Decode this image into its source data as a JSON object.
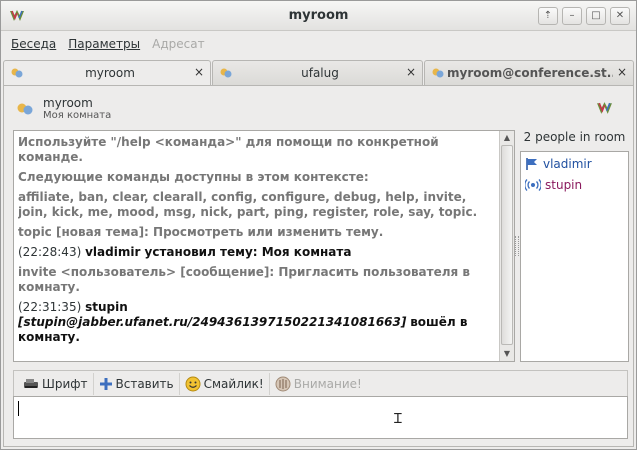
{
  "window": {
    "title": "myroom"
  },
  "window_buttons": [
    "⇡",
    "–",
    "□",
    "✕"
  ],
  "menu": {
    "items": [
      {
        "label": "Беседа",
        "enabled": true
      },
      {
        "label": "Параметры",
        "enabled": true
      },
      {
        "label": "Адресат",
        "enabled": false
      }
    ]
  },
  "tabs": [
    {
      "label": "myroom",
      "active": true,
      "close": "×"
    },
    {
      "label": "ufalug",
      "active": false,
      "close": "×"
    },
    {
      "label": "myroom@conference.st...",
      "active": false,
      "close": "×"
    }
  ],
  "contact": {
    "name": "myroom",
    "status": "Моя комната"
  },
  "chat": {
    "lines": [
      {
        "style": "grey",
        "text": "Используйте \"/help <команда>\" для помощи по конкретной команде."
      },
      {
        "style": "grey",
        "text": "Следующие команды доступны в этом контексте:"
      },
      {
        "style": "grey",
        "text": "affiliate, ban, clear, clearall, config, configure, debug, help, invite, join, kick, me, mood, msg, nick, part, ping, register, role, say, topic."
      },
      {
        "style": "grey",
        "text": "topic [новая тема]:  Просмотреть или изменить тему."
      },
      {
        "time": "(22:28:43)",
        "body": "vladimir установил тему: Моя комната"
      },
      {
        "style": "grey",
        "text": "invite <пользователь> [сообщение]:  Пригласить пользователя в комнату."
      },
      {
        "time": "(22:31:35)",
        "nick": "stupin",
        "jid": "[stupin@jabber.ufanet.ru/24943613971502213410816​63]",
        "tail": "вошёл в комнату."
      }
    ]
  },
  "roster": {
    "header": "2 people in room",
    "people": [
      {
        "name": "vladimir",
        "icon": "flag-icon",
        "color": "#2050a0"
      },
      {
        "name": "stupin",
        "icon": "signal-icon",
        "color": "#8a1a5e"
      }
    ]
  },
  "compose_toolbar": {
    "font": "Шрифт",
    "insert": "Вставить",
    "smiley": "Смайлик!",
    "attention": "Внимание!"
  },
  "compose": {
    "value": ""
  }
}
